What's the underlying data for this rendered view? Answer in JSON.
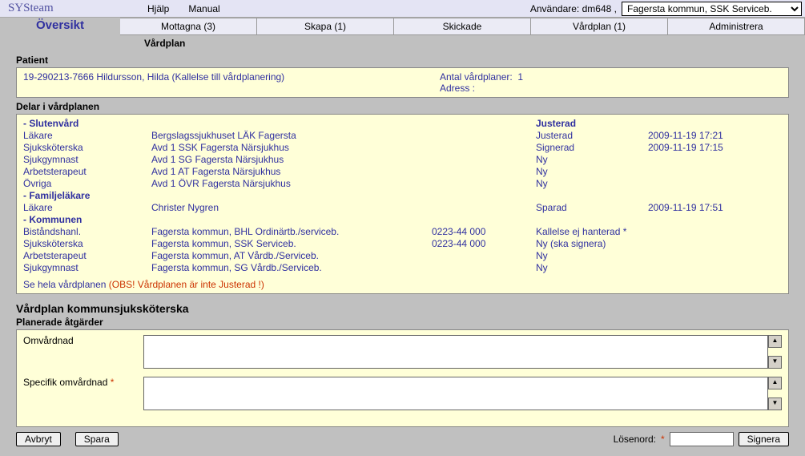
{
  "brand": "SYSteam",
  "top_links": {
    "help": "Hjälp",
    "manual": "Manual"
  },
  "user": {
    "label": "Användare:",
    "name": "dm648",
    "sep": ","
  },
  "org_select": {
    "selected": "Fagersta kommun, SSK Serviceb."
  },
  "tabs": {
    "overview": "Översikt",
    "received": "Mottagna (3)",
    "create": "Skapa (1)",
    "sent": "Skickade",
    "careplan": "Vårdplan (1)",
    "admin": "Administrera"
  },
  "submenu": {
    "careplan": "Vårdplan"
  },
  "patient_header": "Patient",
  "patient": {
    "line": "19-290213-7666  Hildursson, Hilda  (Kallelse till vårdplanering)",
    "count_label": "Antal vårdplaner:",
    "count_value": "1",
    "address_label": "Adress :"
  },
  "parts_header": "Delar i vårdplanen",
  "grp_slutenvard": {
    "title": "- Slutenvård",
    "justerad_head": "Justerad",
    "rows": [
      {
        "role": "Läkare",
        "unit": "Bergslagssjukhuset LÄK Fagersta",
        "phone": "",
        "status": "Justerad",
        "time": "2009-11-19 17:21"
      },
      {
        "role": "Sjuksköterska",
        "unit": "Avd 1 SSK Fagersta Närsjukhus",
        "phone": "",
        "status": "Signerad",
        "time": "2009-11-19 17:15"
      },
      {
        "role": "Sjukgymnast",
        "unit": "Avd 1 SG Fagersta Närsjukhus",
        "phone": "",
        "status": "Ny",
        "time": ""
      },
      {
        "role": "Arbetsterapeut",
        "unit": "Avd 1 AT Fagersta Närsjukhus",
        "phone": "",
        "status": "Ny",
        "time": ""
      },
      {
        "role": "Övriga",
        "unit": "Avd 1 ÖVR Fagersta Närsjukhus",
        "phone": "",
        "status": "Ny",
        "time": ""
      }
    ]
  },
  "grp_familjelakare": {
    "title": "- Familjeläkare",
    "rows": [
      {
        "role": "Läkare",
        "unit": "Christer Nygren",
        "phone": "",
        "status": "Sparad",
        "time": "2009-11-19 17:51"
      }
    ]
  },
  "grp_kommunen": {
    "title": "- Kommunen",
    "rows": [
      {
        "role": "Biståndshanl.",
        "unit": "Fagersta kommun, BHL Ordinärtb./serviceb.",
        "phone": "0223-44 000",
        "status": "Kallelse ej hanterad *",
        "time": ""
      },
      {
        "role": "Sjuksköterska",
        "unit": "Fagersta kommun, SSK Serviceb.",
        "phone": "0223-44 000",
        "status": "Ny (ska signera)",
        "time": ""
      },
      {
        "role": "Arbetsterapeut",
        "unit": "Fagersta kommun, AT Vårdb./Serviceb.",
        "phone": "",
        "status": "Ny",
        "time": ""
      },
      {
        "role": "Sjukgymnast",
        "unit": "Fagersta kommun, SG Vårdb./Serviceb.",
        "phone": "",
        "status": "Ny",
        "time": ""
      }
    ]
  },
  "whole_link": {
    "text": "Se hela vårdplanen",
    "warn": "(OBS! Vårdplanen är inte Justerad !)"
  },
  "form": {
    "title": "Vårdplan kommunsjuksköterska",
    "subtitle": "Planerade åtgärder",
    "field1_label": "Omvårdnad",
    "field2_label": "Specifik omvårdnad",
    "star": "*"
  },
  "buttons": {
    "cancel": "Avbryt",
    "save": "Spara",
    "sign": "Signera"
  },
  "password": {
    "label": "Lösenord:",
    "star": "*"
  }
}
